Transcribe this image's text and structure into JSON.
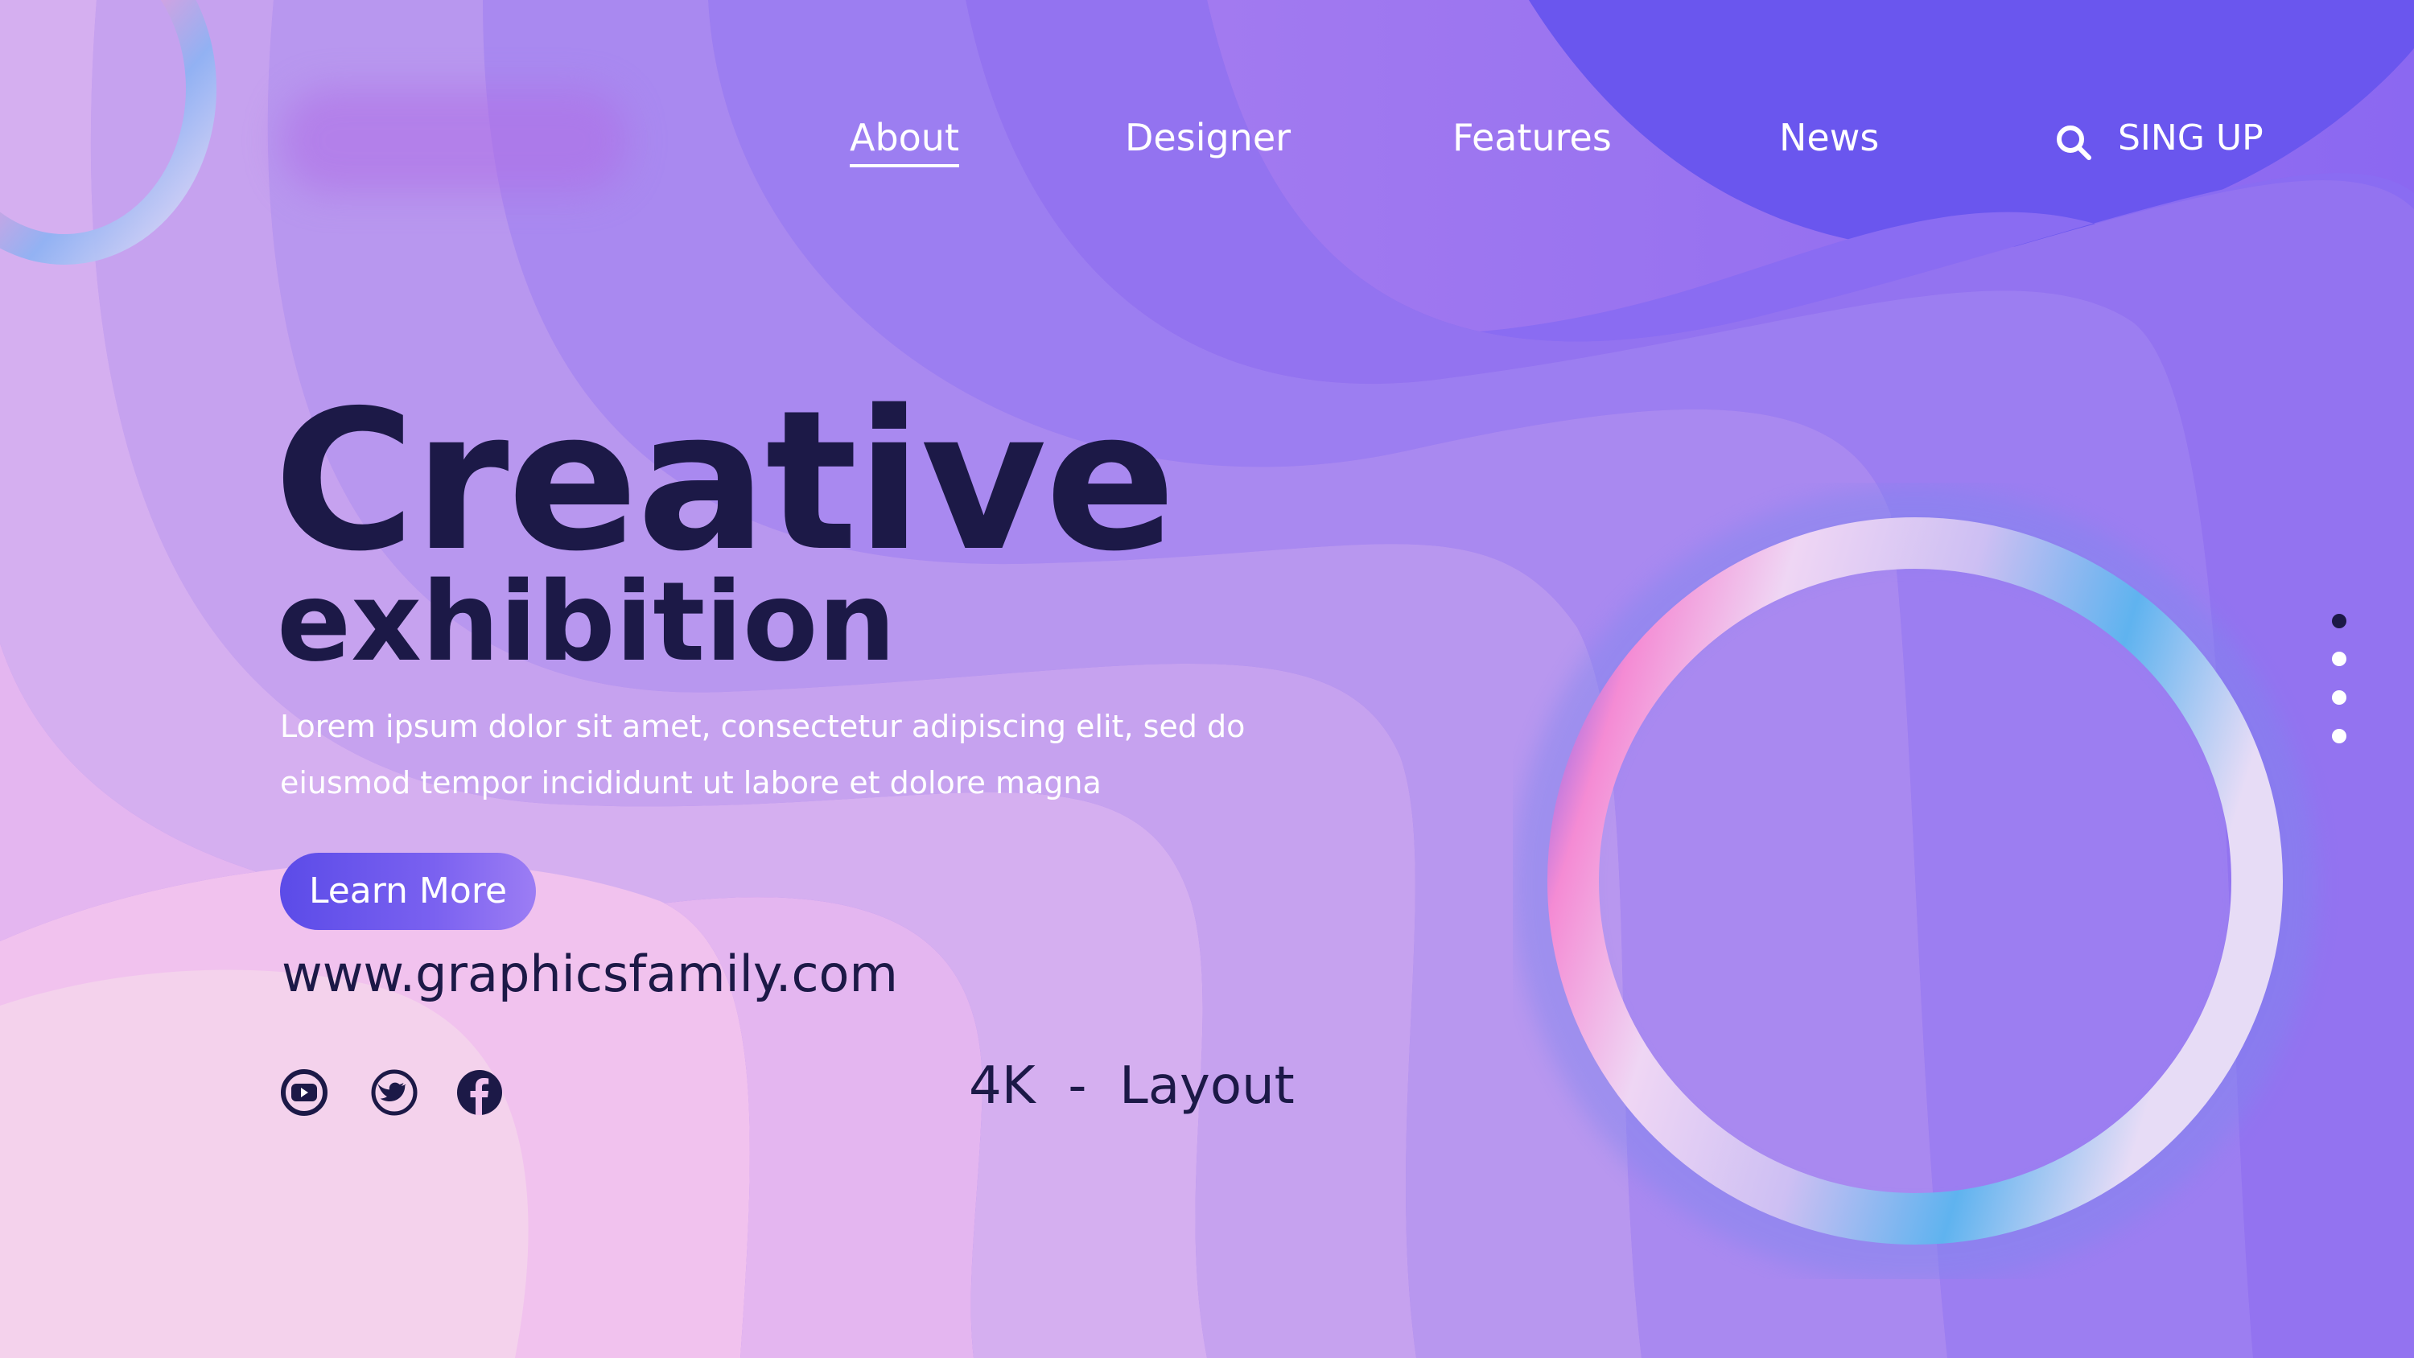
{
  "nav": {
    "items": [
      {
        "label": "About",
        "active": true
      },
      {
        "label": "Designer",
        "active": false
      },
      {
        "label": "Features",
        "active": false
      },
      {
        "label": "News",
        "active": false
      }
    ],
    "search_icon": "search-icon",
    "signup_label": "SING UP"
  },
  "hero": {
    "title": "Creative",
    "subtitle": "exhibition",
    "description": "Lorem ipsum dolor sit amet, consectetur adipiscing elit, sed do eiusmod tempor incididunt ut labore et dolore magna",
    "button_label": "Learn More",
    "website": "www.graphicsfamily.com",
    "tagline": "4K  -  Layout"
  },
  "social": [
    {
      "icon": "youtube-icon"
    },
    {
      "icon": "twitter-icon"
    },
    {
      "icon": "facebook-icon"
    }
  ],
  "pagination": {
    "total": 4,
    "active_index": 0
  },
  "colors": {
    "text_dark": "#1c1947",
    "button": "#6a55ee",
    "background_purple": "#7d5cf0",
    "background_pink": "#f1c8ee"
  }
}
